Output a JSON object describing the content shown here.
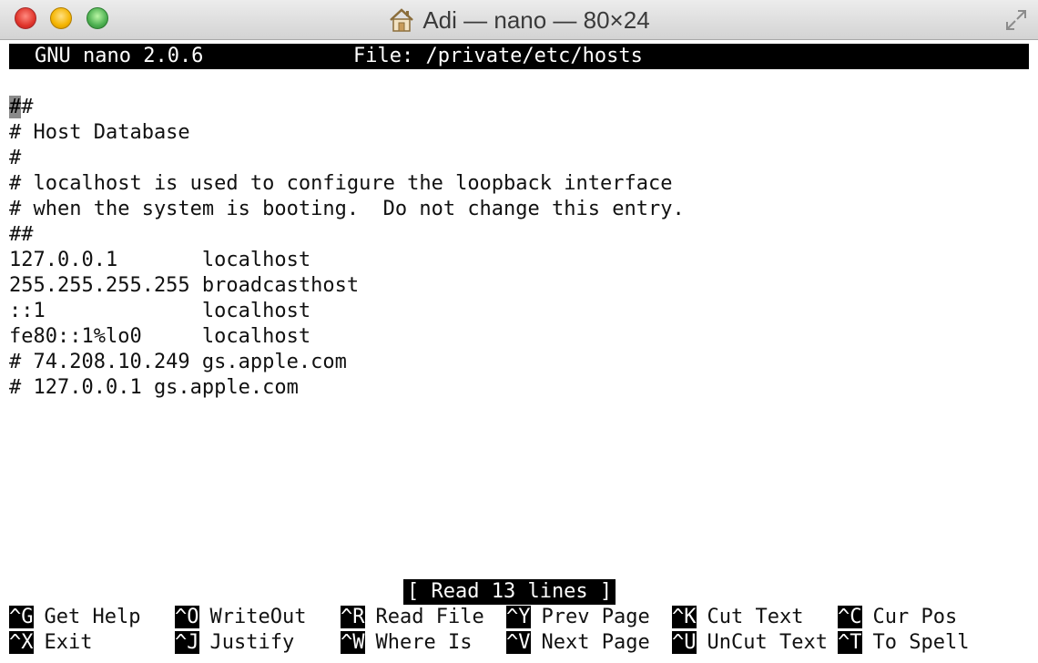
{
  "window": {
    "title": "Adi — nano — 80×24"
  },
  "nano": {
    "version_label": "GNU nano 2.0.6",
    "file_label": "File: /private/etc/hosts",
    "status_message": "[ Read 13 lines ]"
  },
  "file_lines": [
    "##",
    "# Host Database",
    "#",
    "# localhost is used to configure the loopback interface",
    "# when the system is booting.  Do not change this entry.",
    "##",
    "127.0.0.1       localhost",
    "255.255.255.255 broadcasthost",
    "::1             localhost",
    "fe80::1%lo0     localhost",
    "# 74.208.10.249 gs.apple.com",
    "# 127.0.0.1 gs.apple.com"
  ],
  "shortcuts": [
    {
      "key": "^G",
      "label": "Get Help"
    },
    {
      "key": "^O",
      "label": "WriteOut"
    },
    {
      "key": "^R",
      "label": "Read File"
    },
    {
      "key": "^Y",
      "label": "Prev Page"
    },
    {
      "key": "^K",
      "label": "Cut Text"
    },
    {
      "key": "^C",
      "label": "Cur Pos"
    },
    {
      "key": "^X",
      "label": "Exit"
    },
    {
      "key": "^J",
      "label": "Justify"
    },
    {
      "key": "^W",
      "label": "Where Is"
    },
    {
      "key": "^V",
      "label": "Next Page"
    },
    {
      "key": "^U",
      "label": "UnCut Text"
    },
    {
      "key": "^T",
      "label": "To Spell"
    }
  ],
  "icons": {
    "home": "home-icon",
    "fullscreen": "fullscreen-icon"
  },
  "colors": {
    "close": "#e0352b",
    "minimize": "#f4b400",
    "zoom": "#4caf50",
    "inverse_bg": "#000000",
    "cursor": "#8a8a8a"
  }
}
